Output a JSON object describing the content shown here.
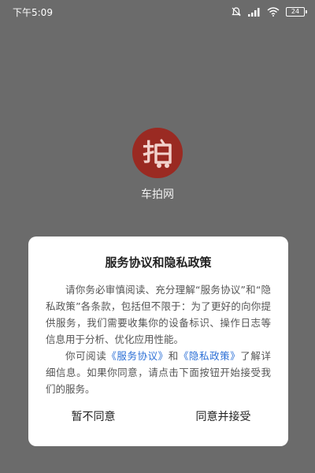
{
  "status_bar": {
    "time": "下午5:09",
    "battery": "24",
    "icons": [
      "no-disturb-icon",
      "signal-icon",
      "wifi-icon",
      "battery-icon"
    ]
  },
  "app": {
    "name": "车拍网",
    "logo_char": "拍",
    "logo_color": "#9a2a22"
  },
  "dialog": {
    "title": "服务协议和隐私政策",
    "para1": "请你务必审慎阅读、充分理解“服务协议”和“隐私政策”各条款，包括但不限于：为了更好的向你提供服务，我们需要收集你的设备标识、操作日志等信息用于分析、优化应用性能。",
    "para2_prefix": "你可阅读",
    "link_service": "《服务协议》",
    "para2_and": "和",
    "link_privacy": "《隐私政策》",
    "para2_suffix": "了解详细信息。如果你同意，请点击下面按钮开始接受我们的服务。",
    "disagree_label": "暂不同意",
    "agree_label": "同意并接受",
    "link_color": "#2b6fd6"
  }
}
